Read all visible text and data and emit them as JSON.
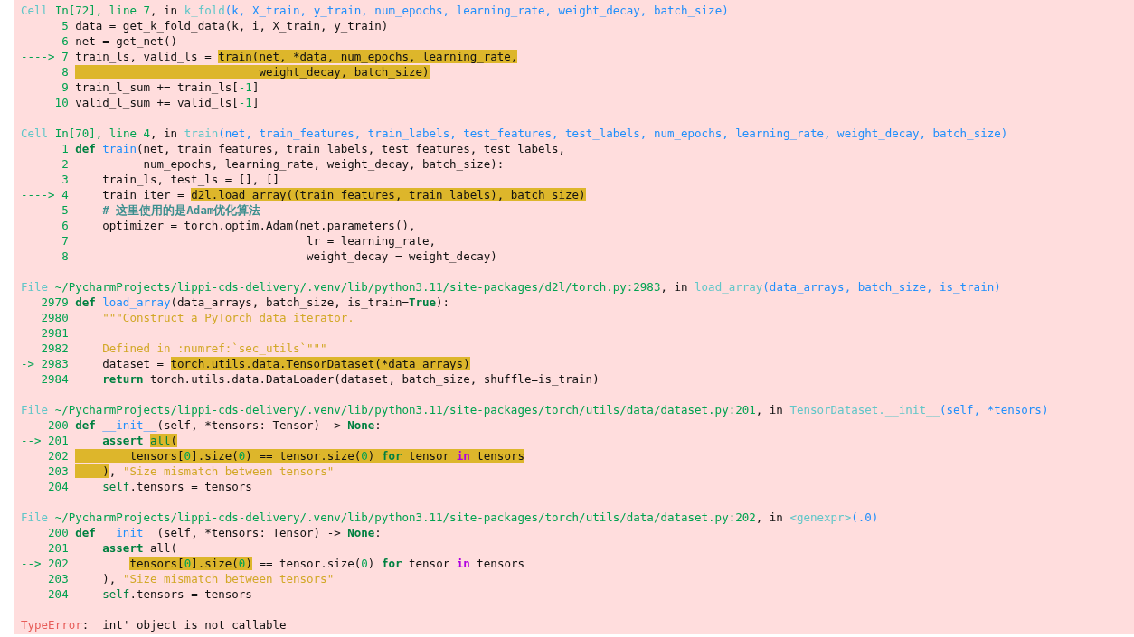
{
  "frames": [
    {
      "header": [
        {
          "text": "Cell",
          "kind": "label"
        },
        {
          "text": " In[72], line 7",
          "kind": "path"
        },
        {
          "text": ", in ",
          "kind": "plain"
        },
        {
          "text": "k_fold",
          "kind": "func"
        },
        {
          "text": "(k, X_train, y_train, num_epochs, learning_rate, weight_decay, batch_size)",
          "kind": "args"
        }
      ],
      "lines": [
        {
          "number": "5",
          "segments": [
            {
              "text": "data = get_k_fold_data(k, i, X_train, y_train)",
              "kind": "plain",
              "highlighted": false
            }
          ]
        },
        {
          "number": "6",
          "segments": [
            {
              "text": "net = get_net()",
              "kind": "plain",
              "highlighted": false
            }
          ]
        },
        {
          "marker": "---->",
          "number": "7",
          "segments": [
            {
              "text": "train_ls, valid_ls = ",
              "kind": "plain",
              "highlighted": false
            },
            {
              "text": "train(net, *data, num_epochs, learning_rate,",
              "kind": "plain",
              "highlighted": true
            }
          ]
        },
        {
          "number": "8",
          "segments": [
            {
              "text": "                           weight_decay, batch_size)",
              "kind": "plain",
              "highlighted": true
            }
          ]
        },
        {
          "number": "9",
          "segments": [
            {
              "text": "train_l_sum += train_ls[",
              "kind": "plain",
              "highlighted": false
            },
            {
              "text": "-1",
              "kind": "number",
              "highlighted": false
            },
            {
              "text": "]",
              "kind": "plain",
              "highlighted": false
            }
          ]
        },
        {
          "number": "10",
          "segments": [
            {
              "text": "valid_l_sum += valid_ls[",
              "kind": "plain",
              "highlighted": false
            },
            {
              "text": "-1",
              "kind": "number",
              "highlighted": false
            },
            {
              "text": "]",
              "kind": "plain",
              "highlighted": false
            }
          ]
        }
      ]
    },
    {
      "header": [
        {
          "text": "Cell",
          "kind": "label"
        },
        {
          "text": " In[70], line 4",
          "kind": "path"
        },
        {
          "text": ", in ",
          "kind": "plain"
        },
        {
          "text": "train",
          "kind": "func"
        },
        {
          "text": "(net, train_features, train_labels, test_features, test_labels, num_epochs, learning_rate, weight_decay, batch_size)",
          "kind": "args"
        }
      ],
      "lines": [
        {
          "number": "1",
          "segments": [
            {
              "text": "def ",
              "kind": "keyword",
              "highlighted": false
            },
            {
              "text": "train",
              "kind": "name",
              "highlighted": false
            },
            {
              "text": "(net, train_features, train_labels, test_features, test_labels,",
              "kind": "plain",
              "highlighted": false
            }
          ]
        },
        {
          "number": "2",
          "segments": [
            {
              "text": "          num_epochs, learning_rate, weight_decay, batch_size):",
              "kind": "plain",
              "highlighted": false
            }
          ]
        },
        {
          "number": "3",
          "segments": [
            {
              "text": "    train_ls, test_ls = [], []",
              "kind": "plain",
              "highlighted": false
            }
          ]
        },
        {
          "marker": "---->",
          "number": "4",
          "segments": [
            {
              "text": "    train_iter = ",
              "kind": "plain",
              "highlighted": false
            },
            {
              "text": "d2l.load_array((train_features, train_labels), batch_size)",
              "kind": "plain",
              "highlighted": true
            }
          ]
        },
        {
          "number": "5",
          "segments": [
            {
              "text": "    # 这里使用的是Adam优化算法",
              "kind": "comment",
              "highlighted": false
            }
          ]
        },
        {
          "number": "6",
          "segments": [
            {
              "text": "    optimizer = torch.optim.Adam(net.parameters(),",
              "kind": "plain",
              "highlighted": false
            }
          ]
        },
        {
          "number": "7",
          "segments": [
            {
              "text": "                                  lr = learning_rate,",
              "kind": "plain",
              "highlighted": false
            }
          ]
        },
        {
          "number": "8",
          "segments": [
            {
              "text": "                                  weight_decay = weight_decay)",
              "kind": "plain",
              "highlighted": false
            }
          ]
        }
      ]
    },
    {
      "header": [
        {
          "text": "File",
          "kind": "label"
        },
        {
          "text": " ~/PycharmProjects/lippi-cds-delivery/.venv/lib/python3.11/site-packages/d2l/torch.py:2983",
          "kind": "path"
        },
        {
          "text": ", in ",
          "kind": "plain"
        },
        {
          "text": "load_array",
          "kind": "func"
        },
        {
          "text": "(data_arrays, batch_size, is_train)",
          "kind": "args"
        }
      ],
      "lines": [
        {
          "number": "2979",
          "segments": [
            {
              "text": "def ",
              "kind": "keyword",
              "highlighted": false
            },
            {
              "text": "load_array",
              "kind": "name",
              "highlighted": false
            },
            {
              "text": "(data_arrays, batch_size, is_train=",
              "kind": "plain",
              "highlighted": false
            },
            {
              "text": "True",
              "kind": "keyword",
              "highlighted": false
            },
            {
              "text": "):",
              "kind": "plain",
              "highlighted": false
            }
          ]
        },
        {
          "number": "2980",
          "segments": [
            {
              "text": "    \"\"\"Construct a PyTorch data iterator.",
              "kind": "string",
              "highlighted": false
            }
          ]
        },
        {
          "number": "2981"
        },
        {
          "number": "2982",
          "segments": [
            {
              "text": "    Defined in :numref:`sec_utils`\"\"\"",
              "kind": "string",
              "highlighted": false
            }
          ]
        },
        {
          "marker": "->",
          "number": "2983",
          "segments": [
            {
              "text": "    dataset = ",
              "kind": "plain",
              "highlighted": false
            },
            {
              "text": "torch.utils.data.TensorDataset(*data_arrays)",
              "kind": "plain",
              "highlighted": true
            }
          ]
        },
        {
          "number": "2984",
          "segments": [
            {
              "text": "    return",
              "kind": "keyword",
              "highlighted": false
            },
            {
              "text": " torch.utils.data.DataLoader(dataset, batch_size, shuffle=is_train)",
              "kind": "plain",
              "highlighted": false
            }
          ]
        }
      ]
    },
    {
      "header": [
        {
          "text": "File",
          "kind": "label"
        },
        {
          "text": " ~/PycharmProjects/lippi-cds-delivery/.venv/lib/python3.11/site-packages/torch/utils/data/dataset.py:201",
          "kind": "path"
        },
        {
          "text": ", in ",
          "kind": "plain"
        },
        {
          "text": "TensorDataset.__init__",
          "kind": "func"
        },
        {
          "text": "(self, *tensors)",
          "kind": "args"
        }
      ],
      "lines": [
        {
          "number": "200",
          "segments": [
            {
              "text": "def ",
              "kind": "keyword",
              "highlighted": false
            },
            {
              "text": "__init__",
              "kind": "name",
              "highlighted": false
            },
            {
              "text": "(self, *tensors: Tensor) -> ",
              "kind": "plain",
              "highlighted": false
            },
            {
              "text": "None",
              "kind": "keyword",
              "highlighted": false
            },
            {
              "text": ":",
              "kind": "plain",
              "highlighted": false
            }
          ]
        },
        {
          "marker": "-->",
          "number": "201",
          "segments": [
            {
              "text": "    assert ",
              "kind": "keyword",
              "highlighted": false
            },
            {
              "text": "all",
              "kind": "builtin",
              "highlighted": true
            },
            {
              "text": "(",
              "kind": "plain",
              "highlighted": true
            }
          ]
        },
        {
          "number": "202",
          "segments": [
            {
              "text": "        tensors[",
              "kind": "plain",
              "highlighted": true
            },
            {
              "text": "0",
              "kind": "number",
              "highlighted": true
            },
            {
              "text": "].size(",
              "kind": "plain",
              "highlighted": true
            },
            {
              "text": "0",
              "kind": "number",
              "highlighted": true
            },
            {
              "text": ") == tensor.size(",
              "kind": "plain",
              "highlighted": true
            },
            {
              "text": "0",
              "kind": "number",
              "highlighted": true
            },
            {
              "text": ") ",
              "kind": "plain",
              "highlighted": true
            },
            {
              "text": "for",
              "kind": "keyword",
              "highlighted": true
            },
            {
              "text": " tensor ",
              "kind": "plain",
              "highlighted": true
            },
            {
              "text": "in",
              "kind": "operator",
              "highlighted": true
            },
            {
              "text": " tensors",
              "kind": "plain",
              "highlighted": true
            }
          ]
        },
        {
          "number": "203",
          "segments": [
            {
              "text": "    )",
              "kind": "plain",
              "highlighted": true
            },
            {
              "text": ", ",
              "kind": "plain",
              "highlighted": false
            },
            {
              "text": "\"Size mismatch between tensors\"",
              "kind": "string",
              "highlighted": false
            }
          ]
        },
        {
          "number": "204",
          "segments": [
            {
              "text": "    self",
              "kind": "builtin",
              "highlighted": false
            },
            {
              "text": ".tensors = tensors",
              "kind": "plain",
              "highlighted": false
            }
          ]
        }
      ]
    },
    {
      "header": [
        {
          "text": "File",
          "kind": "label"
        },
        {
          "text": " ~/PycharmProjects/lippi-cds-delivery/.venv/lib/python3.11/site-packages/torch/utils/data/dataset.py:202",
          "kind": "path"
        },
        {
          "text": ", in ",
          "kind": "plain"
        },
        {
          "text": "<genexpr>",
          "kind": "func"
        },
        {
          "text": "(.0)",
          "kind": "args"
        }
      ],
      "lines": [
        {
          "number": "200",
          "segments": [
            {
              "text": "def ",
              "kind": "keyword",
              "highlighted": false
            },
            {
              "text": "__init__",
              "kind": "name",
              "highlighted": false
            },
            {
              "text": "(self, *tensors: Tensor) -> ",
              "kind": "plain",
              "highlighted": false
            },
            {
              "text": "None",
              "kind": "keyword",
              "highlighted": false
            },
            {
              "text": ":",
              "kind": "plain",
              "highlighted": false
            }
          ]
        },
        {
          "number": "201",
          "segments": [
            {
              "text": "    assert",
              "kind": "keyword",
              "highlighted": false
            },
            {
              "text": " all(",
              "kind": "plain",
              "highlighted": false
            }
          ]
        },
        {
          "marker": "-->",
          "number": "202",
          "segments": [
            {
              "text": "        tensors[",
              "kind": "plain",
              "highlighted": true,
              "indent_highlighted": false
            },
            {
              "text": "0",
              "kind": "number",
              "highlighted": true
            },
            {
              "text": "].size(",
              "kind": "plain",
              "highlighted": true
            },
            {
              "text": "0",
              "kind": "number",
              "highlighted": true
            },
            {
              "text": ")",
              "kind": "plain",
              "highlighted": true
            },
            {
              "text": " == tensor.size(",
              "kind": "plain",
              "highlighted": false
            },
            {
              "text": "0",
              "kind": "number",
              "highlighted": false
            },
            {
              "text": ") ",
              "kind": "plain",
              "highlighted": false
            },
            {
              "text": "for",
              "kind": "keyword",
              "highlighted": false
            },
            {
              "text": " tensor ",
              "kind": "plain",
              "highlighted": false
            },
            {
              "text": "in",
              "kind": "operator",
              "highlighted": false
            },
            {
              "text": " tensors",
              "kind": "plain",
              "highlighted": false
            }
          ]
        },
        {
          "number": "203",
          "segments": [
            {
              "text": "    ), ",
              "kind": "plain",
              "highlighted": false
            },
            {
              "text": "\"Size mismatch between tensors\"",
              "kind": "string",
              "highlighted": false
            }
          ]
        },
        {
          "number": "204",
          "segments": [
            {
              "text": "    self",
              "kind": "builtin",
              "highlighted": false
            },
            {
              "text": ".tensors = tensors",
              "kind": "plain",
              "highlighted": false
            }
          ]
        }
      ]
    }
  ],
  "error": {
    "type": "TypeError",
    "message": ": 'int' object is not callable"
  }
}
